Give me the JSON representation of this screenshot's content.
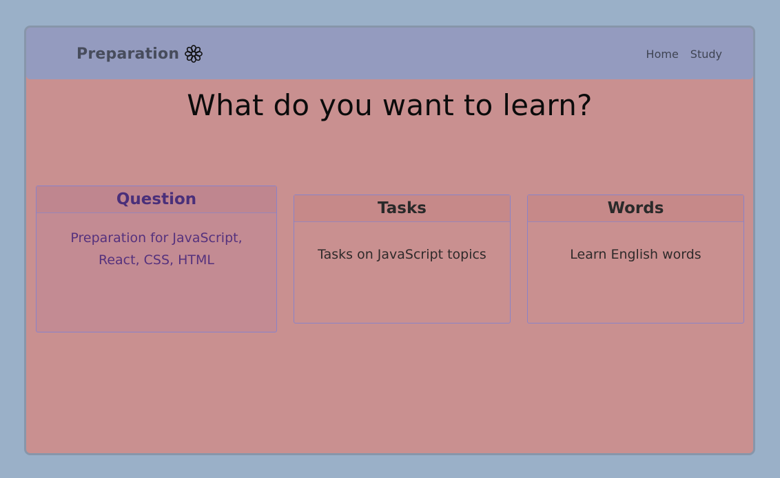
{
  "navbar": {
    "brand": "Preparation",
    "brand_icon": "flower-icon",
    "links": [
      {
        "label": "Home"
      },
      {
        "label": "Study"
      }
    ]
  },
  "main": {
    "title": "What do you want to learn?"
  },
  "cards": {
    "question": {
      "title": "Question",
      "description": "Preparation for JavaScript, React, CSS, HTML"
    },
    "tasks": {
      "title": "Tasks",
      "description": "Tasks on JavaScript topics"
    },
    "words": {
      "title": "Words",
      "description": "Learn English words"
    }
  },
  "colors": {
    "page_background": "#9ab0c8",
    "navbar_background": "#949bbf",
    "content_background": "#c99090",
    "accent_purple": "#4a2f7a"
  }
}
